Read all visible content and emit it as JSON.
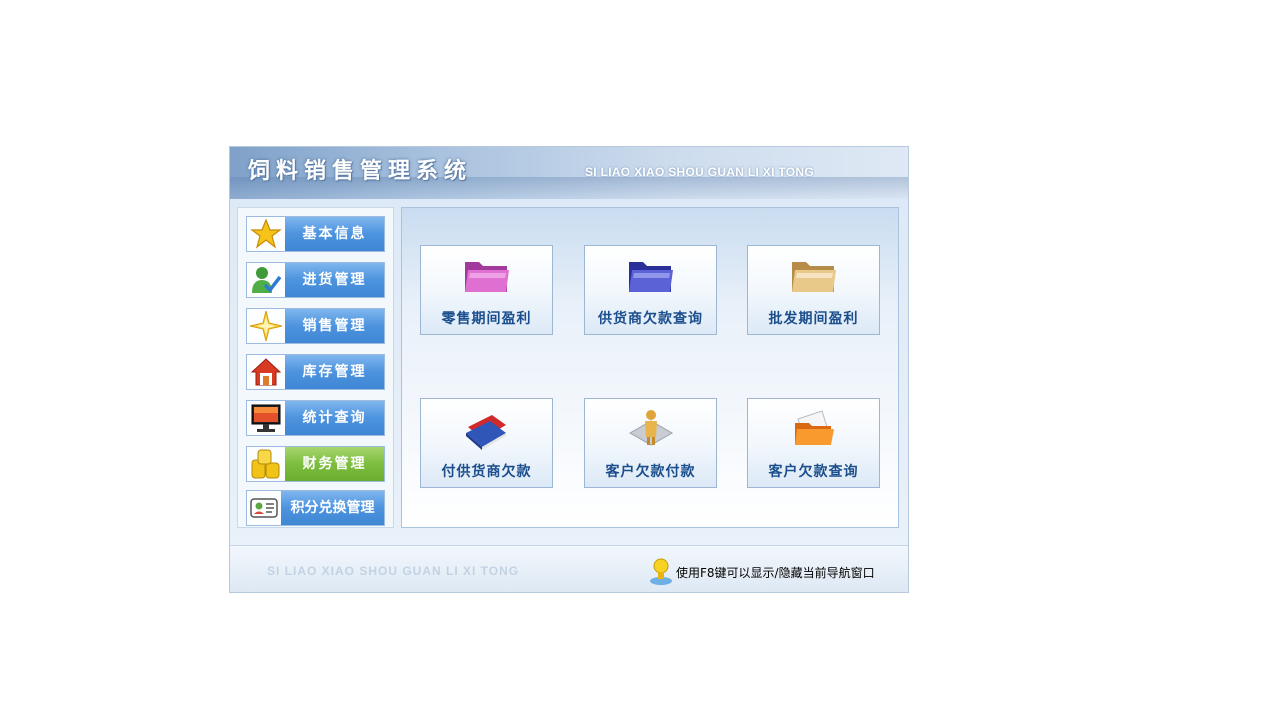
{
  "header": {
    "title": "饲料销售管理系统",
    "subtitle": "SI LIAO XIAO SHOU GUAN LI XI TONG"
  },
  "sidebar": {
    "items": [
      {
        "label": "基本信息",
        "icon": "star-icon"
      },
      {
        "label": "进货管理",
        "icon": "user-check-icon"
      },
      {
        "label": "销售管理",
        "icon": "sparkle-star-icon"
      },
      {
        "label": "库存管理",
        "icon": "house-icon"
      },
      {
        "label": "统计查询",
        "icon": "monitor-icon"
      },
      {
        "label": "财务管理",
        "icon": "coins-icon",
        "active": true
      },
      {
        "label": "积分兑换管理",
        "icon": "id-card-icon"
      }
    ]
  },
  "main": {
    "cards": [
      {
        "label": "零售期间盈利",
        "icon": "pink-folder-icon"
      },
      {
        "label": "供货商欠款查询",
        "icon": "blue-folder-icon"
      },
      {
        "label": "批发期间盈利",
        "icon": "beige-folder-icon"
      },
      {
        "label": "付供货商欠款",
        "icon": "books-icon"
      },
      {
        "label": "客户欠款付款",
        "icon": "person-icon"
      },
      {
        "label": "客户欠款查询",
        "icon": "orange-folder-icon"
      }
    ]
  },
  "footer": {
    "subtitle": "SI LIAO XIAO SHOU GUAN LI XI TONG",
    "hint": "使用F8键可以显示/隐藏当前导航窗口",
    "hint_icon": "lightbulb-icon"
  },
  "colors": {
    "nav_blue": "#4d93de",
    "nav_active_green": "#7dbd3f",
    "card_text": "#1b4e8c"
  }
}
